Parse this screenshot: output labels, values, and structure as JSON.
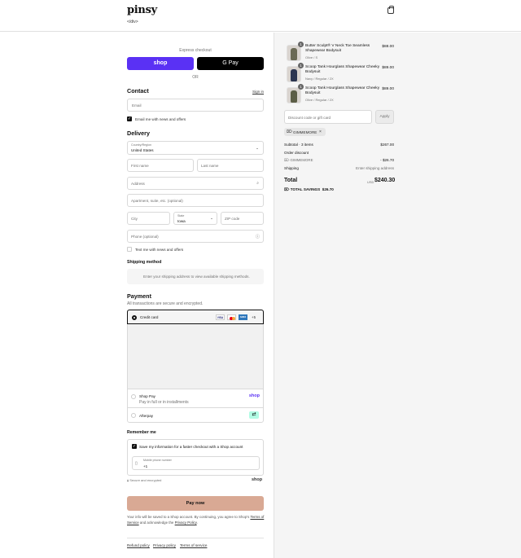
{
  "header": {
    "logo": "pinsy",
    "logo_sub": "</div>",
    "bag_icon": "shopping-bag-icon"
  },
  "express": {
    "label": "Express checkout",
    "shop_pay": "shop",
    "gpay": "G Pay",
    "or": "OR"
  },
  "contact": {
    "title": "Contact",
    "sign_in": "Sign in",
    "email_placeholder": "Email",
    "news_label": "Email me with news and offers"
  },
  "delivery": {
    "title": "Delivery",
    "country_label": "Country/Region",
    "country_value": "United States",
    "first_name": "First name",
    "last_name": "Last name",
    "address": "Address",
    "apartment": "Apartment, suite, etc. (optional)",
    "city": "City",
    "state_label": "State",
    "state_value": "Iowa",
    "zip": "ZIP code",
    "phone": "Phone (optional)",
    "text_label": "Text me with news and offers"
  },
  "shipping": {
    "title": "Shipping method",
    "message": "Enter your shipping address to view available shipping methods."
  },
  "payment": {
    "title": "Payment",
    "subtitle": "All transactions are secure and encrypted.",
    "credit_card": "Credit card",
    "cards": [
      "VISA",
      "MC",
      "AMEX"
    ],
    "more": "+5",
    "shop_pay_title": "Shop Pay",
    "shop_pay_sub": "Pay in full or in installments",
    "shop_pay_logo": "shop",
    "afterpay": "Afterpay"
  },
  "remember": {
    "title": "Remember me",
    "save_label": "Save my information for a faster checkout with a Shop account",
    "phone_label": "Mobile phone number",
    "phone_value": "+1",
    "secure": "Secure and encrypted",
    "shop_logo": "shop"
  },
  "pay_now": "Pay now",
  "legal": {
    "text1": "Your info will be saved to a Shop account. By continuing, you agree to Shop's",
    "terms": "Terms of Service",
    "text2": "and acknowledge the",
    "privacy": "Privacy Policy",
    "end": "."
  },
  "footer": {
    "refund": "Refund policy",
    "privacy": "Privacy policy",
    "terms": "Terms of service"
  },
  "cart": {
    "items": [
      {
        "qty": "1",
        "name": "Butter Sculpt® V Neck Toe Seamless Shapewear Bodysuit",
        "variant": "Olive / S",
        "price": "$88.00",
        "color": "#6b6a55"
      },
      {
        "qty": "1",
        "name": "Scoop Tank Hourglass Shapewear Cheeky Bodysuit",
        "variant": "Navy / Regular / 2X",
        "price": "$89.00",
        "color": "#2c3550"
      },
      {
        "qty": "1",
        "name": "Scoop Tank Hourglass Shapewear Cheeky Bodysuit",
        "variant": "Olive / Regular / 2X",
        "price": "$89.00",
        "color": "#5c5e46"
      }
    ],
    "discount_placeholder": "Discount code or gift card",
    "apply": "Apply",
    "code": "GIMMEMORE",
    "subtotal_label": "Subtotal · 3 items",
    "subtotal": "$267.00",
    "order_discount": "Order discount",
    "discount_code": "GIMMEMORE",
    "discount_value": "- $26.70",
    "shipping_label": "Shipping",
    "shipping_value": "Enter shipping address",
    "total_label": "Total",
    "currency": "USD",
    "total": "$240.30",
    "savings_label": "TOTAL SAVINGS",
    "savings": "$26.70"
  }
}
